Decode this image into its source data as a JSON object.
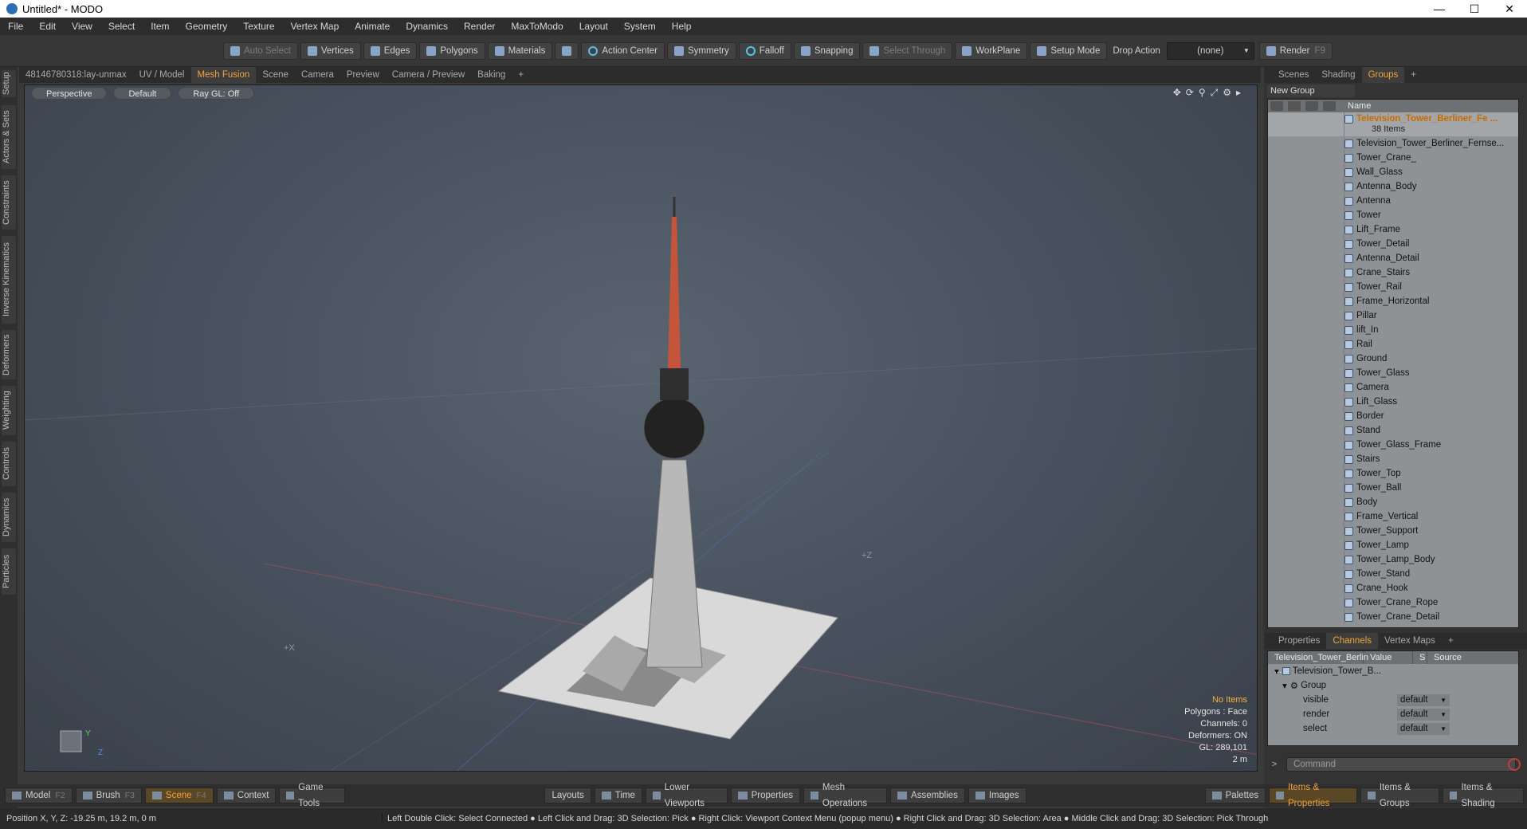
{
  "window": {
    "title": "Untitled* - MODO",
    "min": "—",
    "max": "☐",
    "close": "✕"
  },
  "menu": [
    "File",
    "Edit",
    "View",
    "Select",
    "Item",
    "Geometry",
    "Texture",
    "Vertex Map",
    "Animate",
    "Dynamics",
    "Render",
    "MaxToModo",
    "Layout",
    "System",
    "Help"
  ],
  "toolbar": {
    "auto_select": "Auto Select",
    "vertices": "Vertices",
    "edges": "Edges",
    "polygons": "Polygons",
    "materials": "Materials",
    "action_center": "Action Center",
    "symmetry": "Symmetry",
    "falloff": "Falloff",
    "snapping": "Snapping",
    "select_through": "Select Through",
    "workplane": "WorkPlane",
    "setup_mode": "Setup Mode",
    "drop_action_label": "Drop Action",
    "drop_action_value": "(none)",
    "render": "Render",
    "render_key": "F9"
  },
  "left_tabs": [
    "Setup",
    "Actors & Sets",
    "Constraints",
    "Inverse Kinematics",
    "Deformers",
    "Weighting",
    "Controls",
    "Dynamics",
    "Particles"
  ],
  "viewport_tabs": [
    "48146780318:lay-unmax",
    "UV / Model",
    "Mesh Fusion",
    "Scene",
    "Camera",
    "Preview",
    "Camera / Preview",
    "Baking",
    "+"
  ],
  "viewport": {
    "perspective": "Perspective",
    "shading": "Default",
    "raygl": "Ray GL: Off",
    "info": {
      "no_items": "No Items",
      "polygons": "Polygons : Face",
      "channels": "Channels: 0",
      "deformers": "Deformers: ON",
      "gl": "GL: 289,101",
      "scale": "2 m"
    },
    "axis_x": "X",
    "axis_y": "Y",
    "axis_z": "Z",
    "plus_x": "+X",
    "plus_z": "+Z"
  },
  "right_tabs": [
    "Scenes",
    "Shading",
    "Groups",
    "+"
  ],
  "groups": {
    "new_group": "New Group",
    "name_header": "Name",
    "top_item": "Television_Tower_Berliner_Fe ...",
    "top_count": "38 Items",
    "items": [
      "Television_Tower_Berliner_Fernse...",
      "Tower_Crane_",
      "Wall_Glass",
      "Antenna_Body",
      "Antenna",
      "Tower",
      "Lift_Frame",
      "Tower_Detail",
      "Antenna_Detail",
      "Crane_Stairs",
      "Tower_Rail",
      "Frame_Horizontal",
      "Pillar",
      "lift_In",
      "Rail",
      "Ground",
      "Tower_Glass",
      "Camera",
      "Lift_Glass",
      "Border",
      "Stand",
      "Tower_Glass_Frame",
      "Stairs",
      "Tower_Top",
      "Tower_Ball",
      "Body",
      "Frame_Vertical",
      "Tower_Support",
      "Tower_Lamp",
      "Tower_Lamp_Body",
      "Tower_Stand",
      "Crane_Hook",
      "Tower_Crane_Rope",
      "Tower_Crane_Detail"
    ]
  },
  "bottom_right_tabs": [
    "Properties",
    "Channels",
    "Vertex Maps",
    "+"
  ],
  "channels": {
    "col_name": "Television_Tower_Berlin ...",
    "col_value": "Value",
    "col_s": "S",
    "col_source": "Source",
    "root": "Television_Tower_B...",
    "group": "Group",
    "rows": [
      {
        "name": "visible",
        "value": "default"
      },
      {
        "name": "render",
        "value": "default"
      },
      {
        "name": "select",
        "value": "default"
      }
    ]
  },
  "command_placeholder": "Command",
  "bottom_bar": {
    "model": "Model",
    "model_key": "F2",
    "brush": "Brush",
    "brush_key": "F3",
    "scene": "Scene",
    "scene_key": "F4",
    "context": "Context",
    "game_tools": "Game Tools",
    "layouts": "Layouts",
    "time": "Time",
    "lower_viewports": "Lower Viewports",
    "properties": "Properties",
    "mesh_operations": "Mesh Operations",
    "assemblies": "Assemblies",
    "images": "Images",
    "palettes": "Palettes",
    "items_properties": "Items & Properties",
    "items_groups": "Items & Groups",
    "items_shading": "Items & Shading"
  },
  "status": {
    "position": "Position X, Y, Z:   -19.25 m, 19.2 m, 0 m",
    "hint": "Left Double Click: Select Connected ● Left Click and Drag: 3D Selection: Pick ● Right Click: Viewport Context Menu (popup menu) ● Right Click and Drag: 3D Selection: Area ● Middle Click and Drag: 3D Selection: Pick Through"
  },
  "colors": {
    "accent": "#f2a33a",
    "bg": "#3a3a3a"
  }
}
